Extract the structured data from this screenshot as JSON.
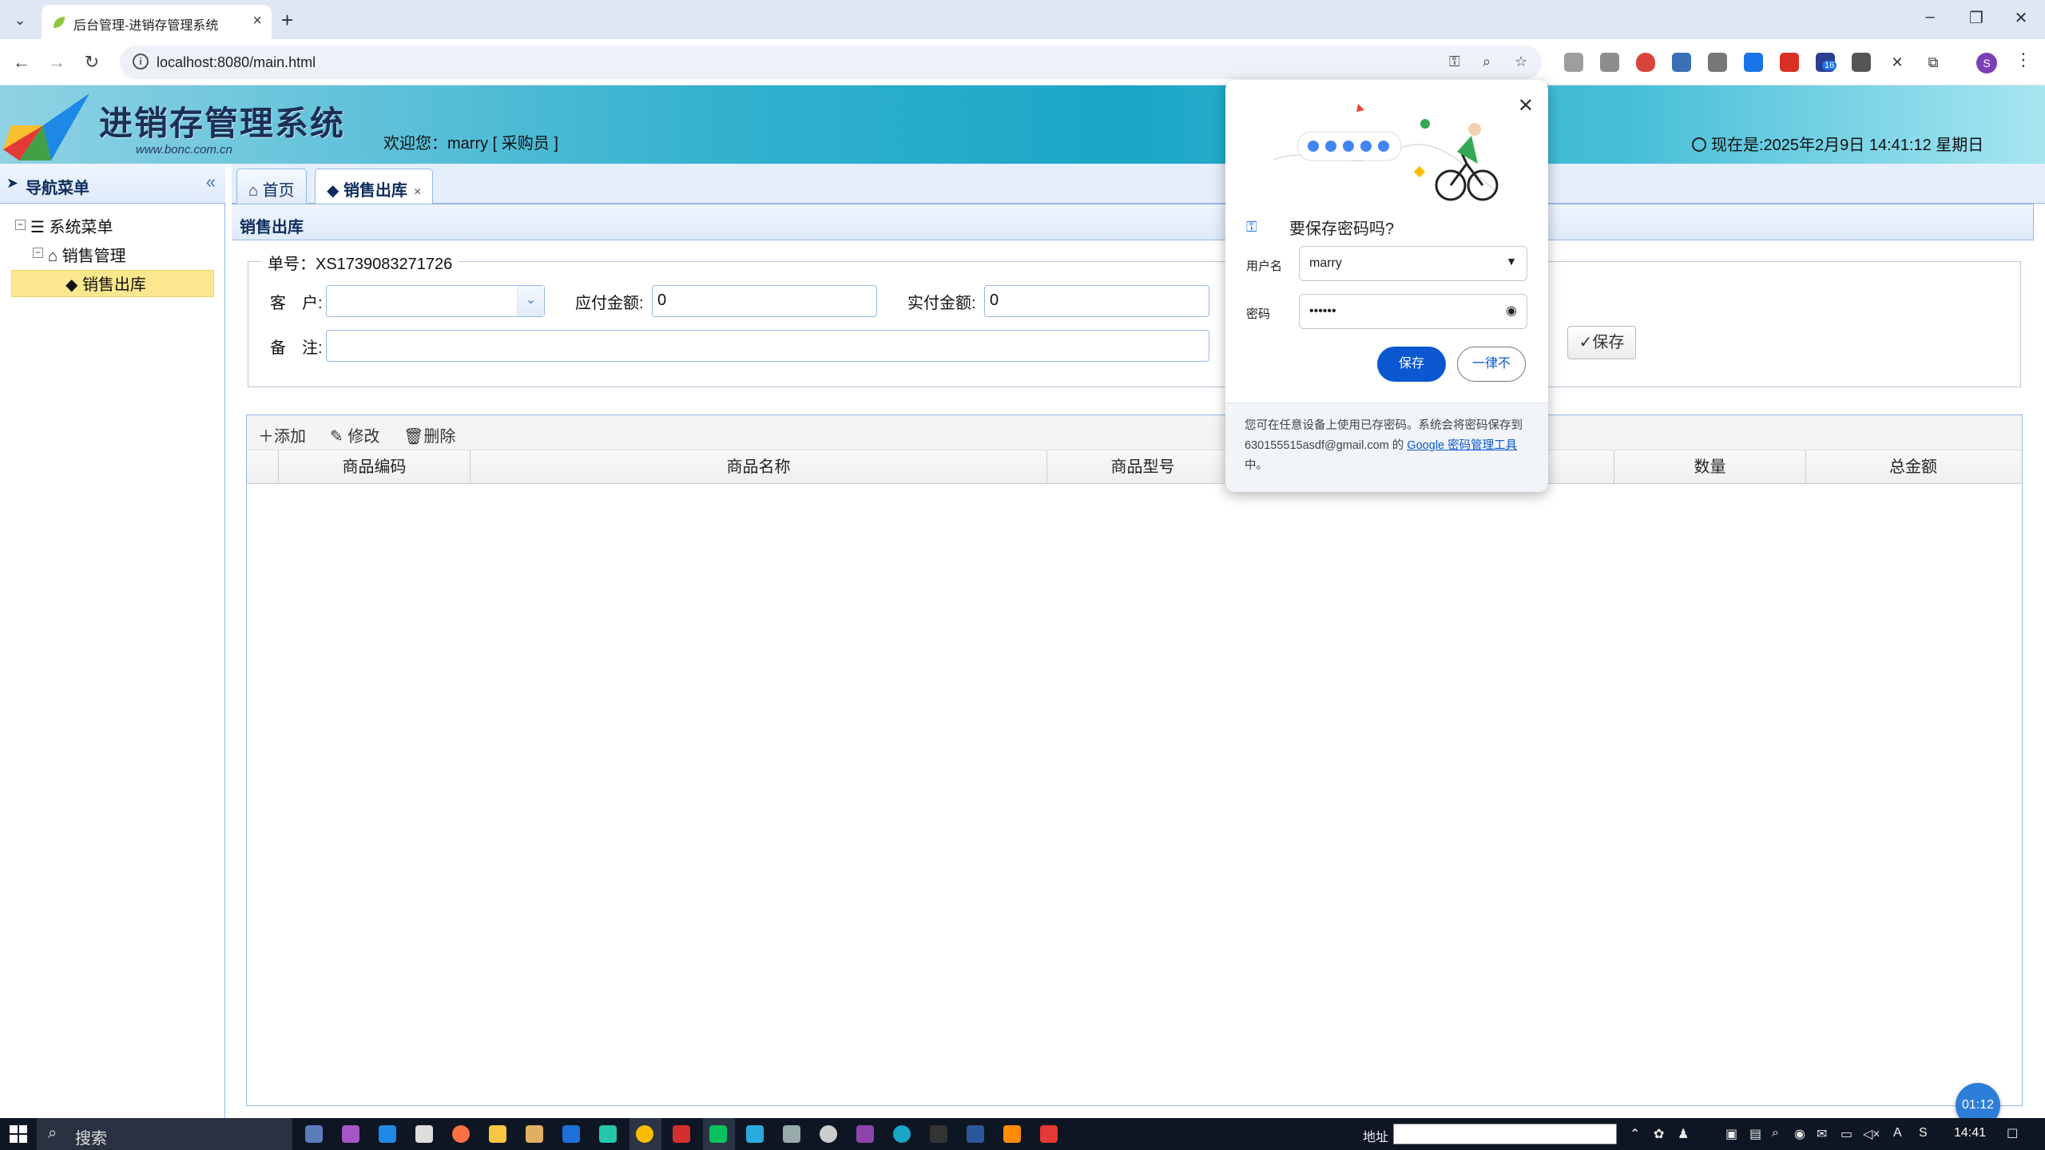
{
  "browser": {
    "tab_title": "后台管理-进销存管理系统",
    "url": "localhost:8080/main.html",
    "extension_badge": "16",
    "profile_initial": "S"
  },
  "header": {
    "logo_title": "进销存管理系统",
    "logo_url": "www.bonc.com.cn",
    "welcome": "欢迎您：marry [ 采购员 ]",
    "clock": "现在是:2025年2月9日 14:41:12 星期日"
  },
  "nav": {
    "title": "导航菜单",
    "collapse_icon": "«",
    "tree": [
      {
        "label": "系统菜单",
        "level": 0,
        "toggle": "⊟"
      },
      {
        "label": "销售管理",
        "level": 1,
        "toggle": "⊟"
      },
      {
        "label": "销售出库",
        "level": 2,
        "selected": true
      }
    ]
  },
  "tabs": [
    {
      "label": "首页",
      "icon": "home-icon"
    },
    {
      "label": "销售出库",
      "icon": "tag-icon",
      "active": true,
      "close": "×"
    }
  ],
  "form": {
    "panel_title": "销售出库",
    "order_legend": "单号：XS1739083271726",
    "customer_label": "客　户:",
    "customer_value": "",
    "payable_label": "应付金额:",
    "payable_value": "0",
    "paid_label": "实付金额:",
    "paid_value": "0",
    "remark_label": "备　注:",
    "remark_value": "",
    "save_label": "保存"
  },
  "grid": {
    "toolbar": {
      "add": "添加",
      "edit": "修改",
      "delete": "删除"
    },
    "columns": [
      "商品编码",
      "商品名称",
      "商品型号",
      "",
      "数量",
      "总金额"
    ]
  },
  "password_popup": {
    "title": "要保存密码吗?",
    "username_label": "用户名",
    "username_value": "marry",
    "password_label": "密码",
    "password_value": "••••••",
    "save_button": "保存",
    "never_button": "一律不",
    "footer_prefix": "您可在任意设备上使用已存密码。系统会将密码保存到 630155515asdf@gmail.com 的 ",
    "footer_link": "Google 密码管理工具",
    "footer_suffix": "中。"
  },
  "timer": "01:12",
  "taskbar": {
    "search": "搜索",
    "address_label": "地址",
    "time": "14:41"
  }
}
